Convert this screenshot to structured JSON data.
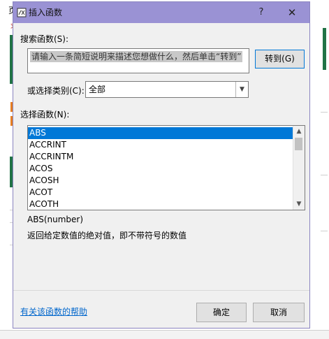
{
  "dialog": {
    "title": "插入函数",
    "help_button": "?",
    "close_button": "✕",
    "search_label": "搜索函数(S):",
    "search_value": "请输入一条简短说明来描述您想做什么，然后单击“转到”",
    "goto_button": "转到(G)",
    "category_label": "或选择类别(C):",
    "category_value": "全部",
    "function_list_label": "选择函数(N):",
    "functions": [
      "ABS",
      "ACCRINT",
      "ACCRINTM",
      "ACOS",
      "ACOSH",
      "ACOT",
      "ACOTH"
    ],
    "selected_function": "ABS",
    "syntax": "ABS(number)",
    "description": "返回给定数值的绝对值，即不带符号的数值",
    "help_link": "有关该函数的帮助",
    "ok_button": "确定",
    "cancel_button": "取消"
  },
  "background": {
    "left_fragment_1": "页",
    "left_fragment_2": "求"
  },
  "colors": {
    "titlebar": "#9a92d4",
    "selection": "#0078d7",
    "link": "#0066cc",
    "excel_green": "#217346"
  }
}
